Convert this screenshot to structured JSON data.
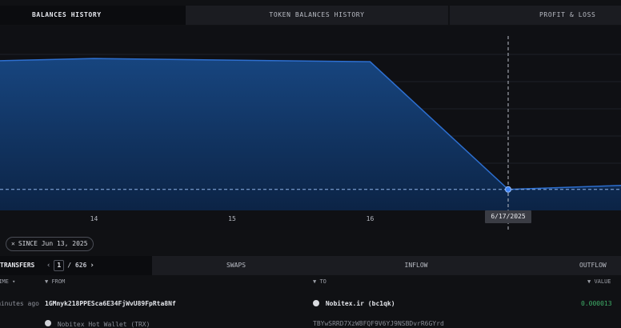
{
  "tabs": [
    {
      "label": "BALANCES HISTORY",
      "active": true
    },
    {
      "label": "TOKEN BALANCES HISTORY",
      "active": false
    },
    {
      "label": "PROFIT & LOSS",
      "active": false
    }
  ],
  "chart_data": {
    "type": "area",
    "x_tick_labels": [
      "14",
      "15",
      "16"
    ],
    "hover_date": "6/17/2025",
    "points": [
      {
        "x": "2025-06-13",
        "y": 0.92
      },
      {
        "x": "2025-06-14",
        "y": 0.94
      },
      {
        "x": "2025-06-16",
        "y": 0.92
      },
      {
        "x": "2025-06-17",
        "y": 0.13
      },
      {
        "x": "2025-06-18",
        "y": 0.16
      }
    ],
    "colors": {
      "fill": "#123a6c",
      "line": "#2d6fd0",
      "crosshair": "#b8bcc6"
    },
    "grid": true,
    "x_axis": "dates",
    "y_axis_labels_visible": false
  },
  "filter": {
    "chip_label": "SINCE Jun 13, 2025",
    "remove_icon": "close-icon"
  },
  "transfers": {
    "title": "TRANSFERS",
    "page": "1",
    "total": "/ 626",
    "segments": [
      "SWAPS",
      "INFLOW",
      "OUTFLOW"
    ]
  },
  "columns": {
    "time": "TIME",
    "from": "FROM",
    "to": "TO",
    "value": "VALUE"
  },
  "rows": [
    {
      "time": "minutes ago",
      "from": "1GMnyk218PPESca6E34FjWvU89FpRta8Nf",
      "to": "Nobitex.ir (bc1qk)",
      "value": "0.000013"
    }
  ],
  "partial_row": {
    "from": "Nobitex Hot Wallet (TRX)",
    "to": "TBYwSRRD7XzW8FQF9V6YJ9NSBDvrR6GYrd"
  }
}
